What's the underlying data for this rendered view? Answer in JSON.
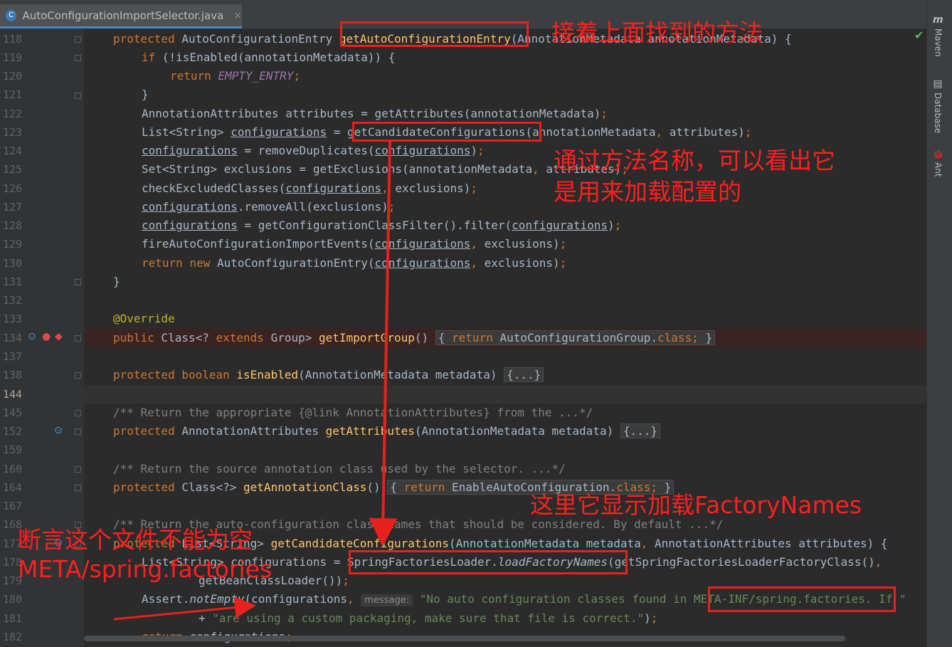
{
  "tab": {
    "icon": "C",
    "title": "AutoConfigurationImportSelector.java",
    "close": "×"
  },
  "right_tools": {
    "maven": "Maven",
    "database": "Database",
    "ant": "Ant",
    "maven_icon": "m",
    "ant_icon": "🐞"
  },
  "status_check": "✔",
  "line_numbers": [
    "118",
    "119",
    "120",
    "121",
    "122",
    "123",
    "124",
    "125",
    "126",
    "127",
    "128",
    "129",
    "130",
    "131",
    "132",
    "133",
    "134",
    "137",
    "138",
    "144",
    "145",
    "152",
    "159",
    "160",
    "164",
    "167",
    "168",
    "177",
    "178",
    "179",
    "180",
    "181",
    "182"
  ],
  "code": {
    "l118": [
      "protected",
      " AutoConfigurationEntry ",
      "getAutoConfigurationEntry",
      "(AnnotationMetadata annotationMetadata) {"
    ],
    "l119": [
      "if",
      " (!isEnabled(annotationMetadata)) {"
    ],
    "l120": [
      "return",
      " ",
      "EMPTY_ENTRY",
      ";"
    ],
    "l121": "}",
    "l122": [
      "AnnotationAttributes attributes = getAttributes(annotationMetadata)",
      ";"
    ],
    "l123": [
      "List<String> ",
      "configurations",
      " = ",
      "getCandidateConfigurations",
      "(annotationMetadata",
      ", ",
      "attributes)",
      ";"
    ],
    "l124": [
      "configurations",
      " = removeDuplicates(",
      "configurations",
      ")",
      ";"
    ],
    "l125": [
      "Set<String> exclusions = getExclusions(annotationMetadata",
      ", ",
      "attributes)",
      ";"
    ],
    "l126": [
      "checkExcludedClasses(",
      "configurations",
      ", ",
      "exclusions)",
      ";"
    ],
    "l127": [
      "configurations",
      ".removeAll(exclusions)",
      ";"
    ],
    "l128": [
      "configurations",
      " = getConfigurationClassFilter().filter(",
      "configurations",
      ")",
      ";"
    ],
    "l129": [
      "fireAutoConfigurationImportEvents(",
      "configurations",
      ", ",
      "exclusions)",
      ";"
    ],
    "l130": [
      "return new",
      " AutoConfigurationEntry(",
      "configurations",
      ", ",
      "exclusions)",
      ";"
    ],
    "l131": "}",
    "l133": "@Override",
    "l134": [
      "public",
      " Class<? ",
      "extends",
      " Group> ",
      "getImportGroup",
      "() ",
      "{ ",
      "return",
      " AutoConfigurationGroup.",
      "class",
      ";",
      " }"
    ],
    "l138": [
      "protected boolean",
      " ",
      "isEnabled",
      "(AnnotationMetadata metadata) ",
      "{...}"
    ],
    "l145": "/** Return the appropriate {@link AnnotationAttributes} from the ...*/",
    "l152": [
      "protected",
      " AnnotationAttributes ",
      "getAttributes",
      "(AnnotationMetadata metadata) ",
      "{...}"
    ],
    "l160": "/** Return the source annotation class used by the selector. ...*/",
    "l164": [
      "protected",
      " Class<?> ",
      "getAnnotationClass",
      "() ",
      "{ ",
      "return",
      " EnableAutoConfiguration.",
      "class",
      ";",
      " }"
    ],
    "l168": "/** Return the auto-configuration class names that should be considered. By default ...*/",
    "l177": [
      "protected",
      " List<String> ",
      "getCandidateConfigurations",
      "(AnnotationMetadata metadata",
      ", ",
      "AnnotationAttributes attributes) {"
    ],
    "l178": [
      "List<String> configurations = ",
      "SpringFactoriesLoader.",
      "loadFactoryNames",
      "(getSpringFactoriesLoaderFactoryClass()",
      ","
    ],
    "l179": [
      "getBeanClassLoader())",
      ";"
    ],
    "l180": [
      "Assert.",
      "notEmpty",
      "(configurations",
      ", ",
      "message:",
      " \"No auto configuration classes found in META-INF/spring.factories. If \""
    ],
    "l181": [
      "+ ",
      "\"are using a custom packaging, make sure that file is correct.\"",
      ")",
      ";"
    ],
    "l182": [
      "return",
      " configurations",
      ";"
    ]
  },
  "notes": {
    "n1": "接着上面找到的方法",
    "n2a": "通过方法名称，可以看出它",
    "n2b": "是用来加载配置的",
    "n3": "这里它显示加载FactoryNames",
    "n4a": "断言这个文件不能为空",
    "n4b": "META/spring.factories"
  },
  "colors": {
    "annotation_red": "#e8211d",
    "keyword": "#cc7832",
    "function": "#ffc66d",
    "string": "#6a8759",
    "comment": "#808080"
  }
}
